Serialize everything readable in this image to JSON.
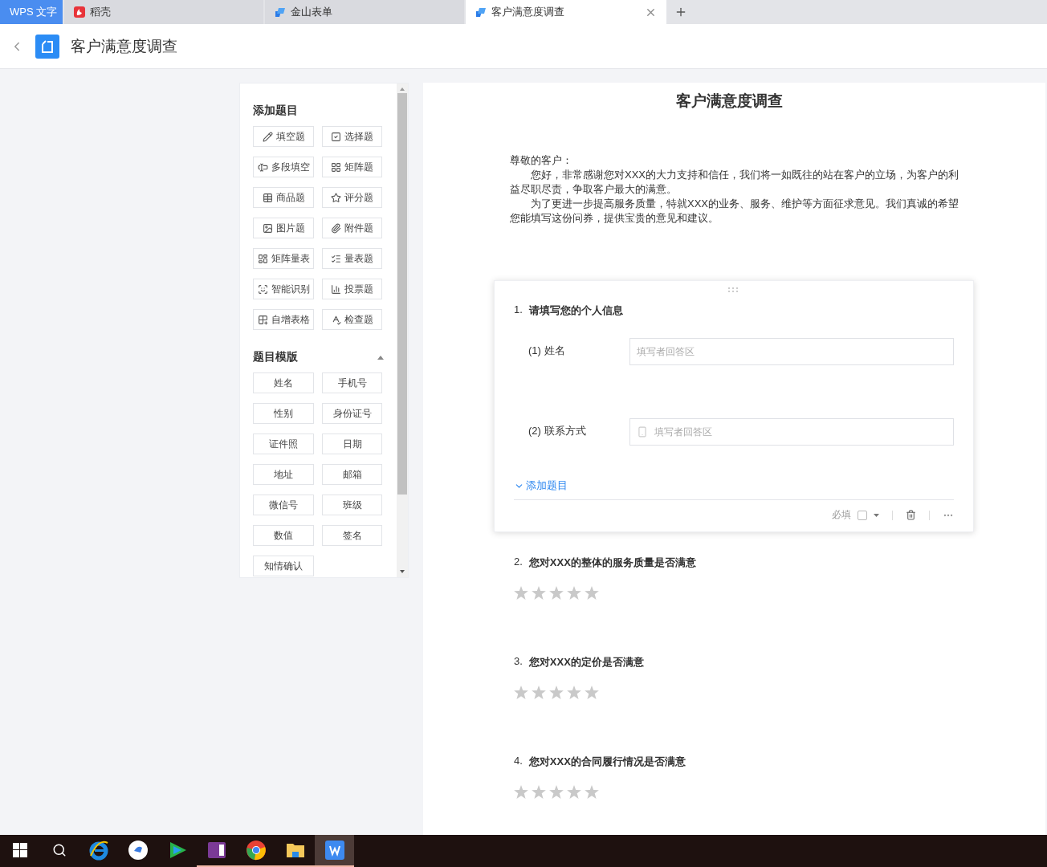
{
  "tabs": [
    {
      "label": "WPS 文字",
      "kind": "home",
      "selected": false
    },
    {
      "label": "稻壳",
      "kind": "docer",
      "selected": false
    },
    {
      "label": "金山表单",
      "kind": "form",
      "selected": false
    },
    {
      "label": "客户满意度调查",
      "kind": "form",
      "selected": true
    }
  ],
  "header": {
    "title": "客户满意度调查"
  },
  "sidebar": {
    "add_title": "添加题目",
    "add_items": [
      "填空题",
      "选择题",
      "多段填空",
      "矩阵题",
      "商品题",
      "评分题",
      "图片题",
      "附件题",
      "矩阵量表",
      "量表题",
      "智能识别",
      "投票题",
      "自增表格",
      "检查题"
    ],
    "template_title": "题目模版",
    "template_expanded": true,
    "template_items": [
      "姓名",
      "手机号",
      "性别",
      "身份证号",
      "证件照",
      "日期",
      "地址",
      "邮箱",
      "微信号",
      "班级",
      "数值",
      "签名",
      "知情确认"
    ]
  },
  "form": {
    "title": "客户满意度调查",
    "greeting": "尊敬的客户：",
    "paragraphs": [
      "您好，非常感谢您对XXX的大力支持和信任，我们将一如既往的站在客户的立场，为客户的利益尽职尽责，争取客户最大的满意。",
      "为了更进一步提高服务质量，特就XXX的业务、服务、维护等方面征求意见。我们真诚的希望您能填写这份问券，提供宝贵的意见和建议。"
    ],
    "questions": [
      {
        "kind": "group",
        "number": "1.",
        "title": "请填写您的个人信息",
        "selected": true,
        "fields": [
          {
            "label": "(1) 姓名",
            "kind": "text",
            "placeholder": "填写者回答区"
          },
          {
            "label": "(2) 联系方式",
            "kind": "phone",
            "placeholder": "填写者回答区"
          }
        ],
        "add_label": "添加题目",
        "required_label": "必填",
        "required": false
      },
      {
        "kind": "rating",
        "number": "2.",
        "title": "您对XXX的整体的服务质量是否满意",
        "selected": false,
        "stars": 0
      },
      {
        "kind": "rating",
        "number": "3.",
        "title": "您对XXX的定价是否满意",
        "selected": false,
        "stars": 0
      },
      {
        "kind": "rating",
        "number": "4.",
        "title": "您对XXX的合同履行情况是否满意",
        "selected": false,
        "stars": 0
      }
    ]
  },
  "taskbar": {
    "apps": [
      {
        "kind": "ie",
        "open": false
      },
      {
        "kind": "feather",
        "open": false
      },
      {
        "kind": "video",
        "open": false
      },
      {
        "kind": "onenote",
        "open": true
      },
      {
        "kind": "chrome",
        "open": true
      },
      {
        "kind": "folder",
        "open": true
      },
      {
        "kind": "wps",
        "open": true,
        "selected": true
      }
    ]
  }
}
